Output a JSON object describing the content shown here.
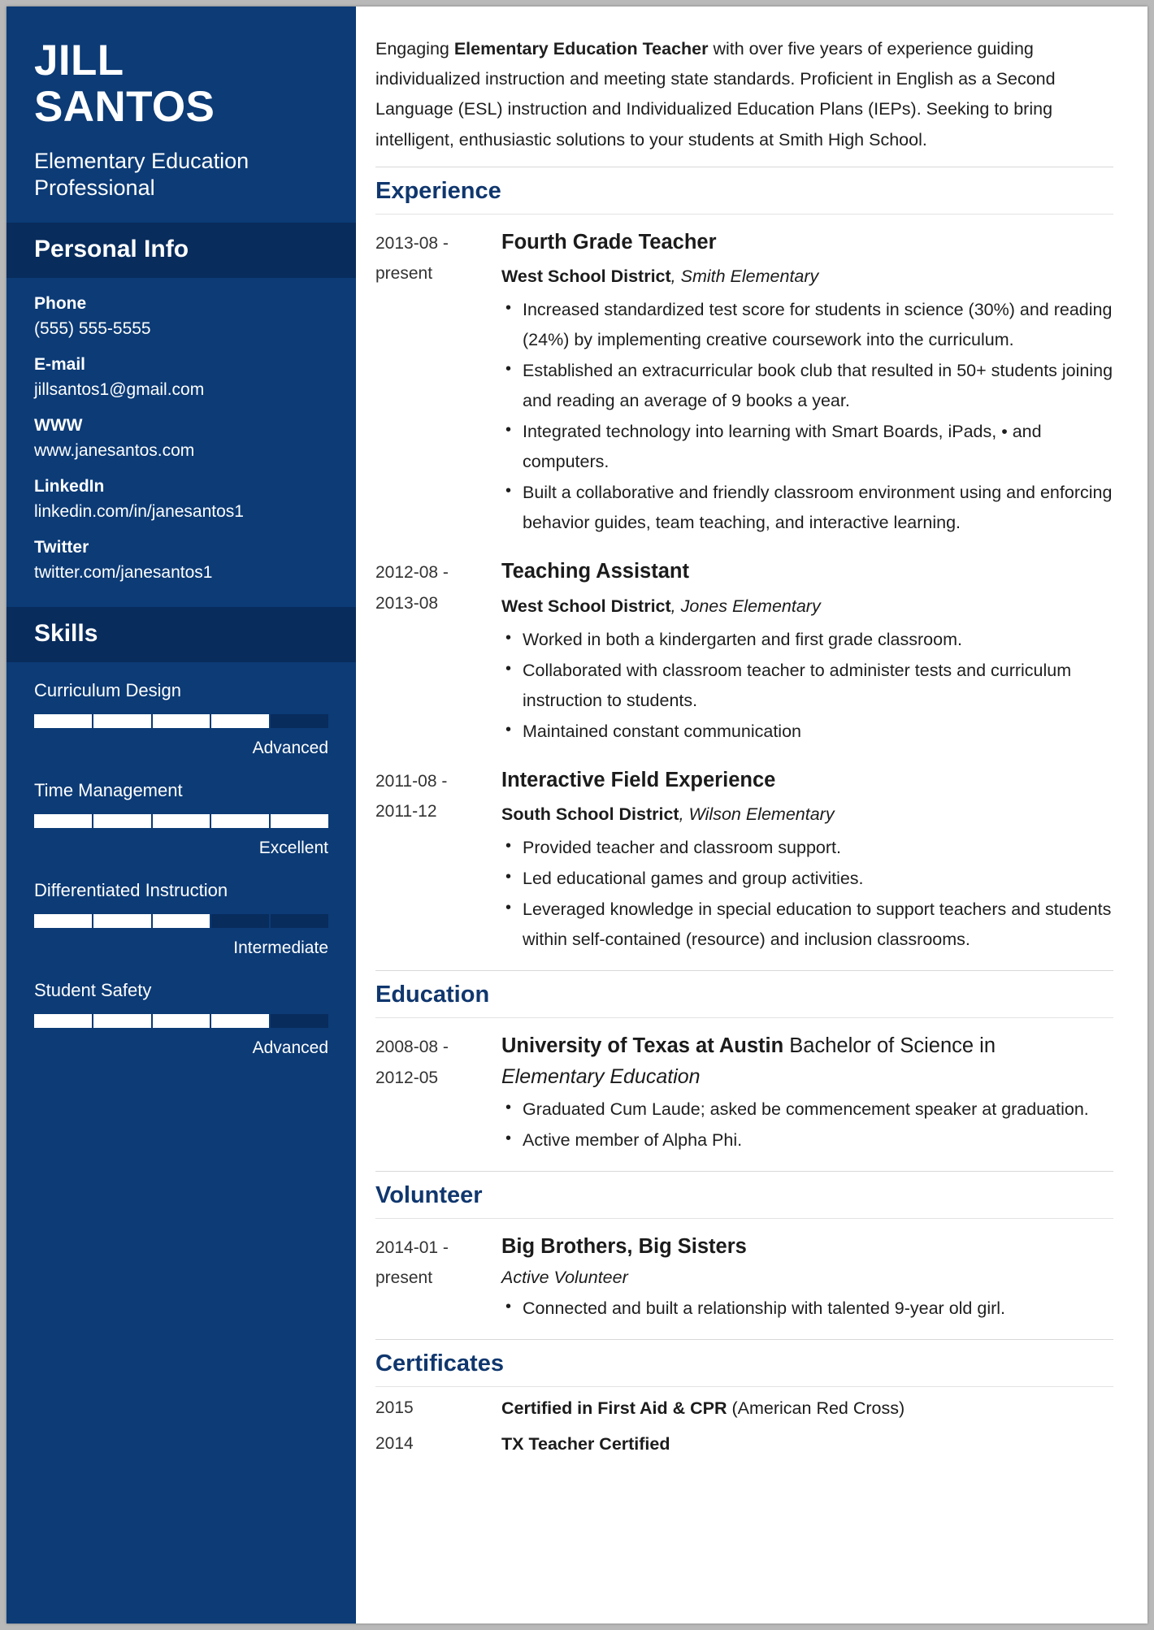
{
  "sidebar": {
    "first_name": "JILL",
    "last_name": "SANTOS",
    "job_title": "Elementary Education Professional",
    "personal_info": {
      "heading": "Personal Info",
      "items": [
        {
          "label": "Phone",
          "value": "(555) 555-5555"
        },
        {
          "label": "E-mail",
          "value": "jillsantos1@gmail.com"
        },
        {
          "label": "WWW",
          "value": "www.janesantos.com"
        },
        {
          "label": "LinkedIn",
          "value": "linkedin.com/in/janesantos1"
        },
        {
          "label": "Twitter",
          "value": "twitter.com/janesantos1"
        }
      ]
    },
    "skills": {
      "heading": "Skills",
      "items": [
        {
          "name": "Curriculum Design",
          "level": "Advanced",
          "percent": 80
        },
        {
          "name": "Time Management",
          "level": "Excellent",
          "percent": 100
        },
        {
          "name": "Differentiated Instruction",
          "level": "Intermediate",
          "percent": 60
        },
        {
          "name": "Student Safety",
          "level": "Advanced",
          "percent": 80
        }
      ]
    }
  },
  "main": {
    "summary": {
      "part1": "Engaging ",
      "bold1": "Elementary Education Teacher",
      "part2": " with over five years of experience guiding individualized instruction and meeting state standards. Proficient in English as a Second Language (ESL) instruction and Individualized Education Plans (IEPs). Seeking to bring intelligent, enthusiastic solutions to your students at Smith High School."
    },
    "experience": {
      "heading": "Experience",
      "entries": [
        {
          "date_from": "2013-08 -",
          "date_to": "present",
          "title": "Fourth Grade Teacher",
          "company": "West School District",
          "location": ", Smith Elementary",
          "bullets": [
            "Increased standardized test score for students in science (30%) and reading (24%) by implementing creative coursework into the curriculum.",
            "Established an extracurricular book club that resulted in 50+ students joining and reading an average of 9 books a year.",
            "Integrated technology into learning with Smart Boards, iPads, • and computers.",
            "Built a collaborative and friendly classroom environment using and enforcing behavior guides, team teaching, and interactive learning."
          ]
        },
        {
          "date_from": "2012-08 -",
          "date_to": "2013-08",
          "title": "Teaching Assistant",
          "company": "West School District",
          "location": ", Jones Elementary",
          "bullets": [
            "Worked in both a kindergarten and first grade classroom.",
            "Collaborated with classroom teacher to administer tests and curriculum instruction to students.",
            "Maintained constant communication"
          ]
        },
        {
          "date_from": "2011-08 -",
          "date_to": "2011-12",
          "title": "Interactive Field Experience",
          "company": "South School District",
          "location": ", Wilson Elementary",
          "bullets": [
            "Provided teacher and classroom support.",
            "Led educational games and group activities.",
            "Leveraged knowledge in special education to support teachers and students within self-contained (resource) and inclusion classrooms."
          ]
        }
      ]
    },
    "education": {
      "heading": "Education",
      "entries": [
        {
          "date_from": "2008-08 -",
          "date_to": "2012-05",
          "school": "University of Texas at Austin",
          "degree_rest": " Bachelor of Science in",
          "degree_italic": "Elementary Education",
          "bullets": [
            "Graduated Cum Laude; asked be commencement speaker at graduation.",
            "Active member of Alpha Phi."
          ]
        }
      ]
    },
    "volunteer": {
      "heading": "Volunteer",
      "entries": [
        {
          "date_from": "2014-01 -",
          "date_to": "present",
          "title": "Big Brothers, Big Sisters",
          "role": "Active Volunteer",
          "bullets": [
            "Connected and built a relationship with talented 9-year old girl."
          ]
        }
      ]
    },
    "certificates": {
      "heading": "Certificates",
      "rows": [
        {
          "year": "2015",
          "bold": "Certified in First Aid & CPR",
          "rest": " (American Red Cross)"
        },
        {
          "year": "2014",
          "bold": "TX Teacher Certified",
          "rest": ""
        }
      ]
    }
  },
  "colors": {
    "sidebar_bg": "#0c3b76",
    "sidebar_head_bg": "#082c5c",
    "accent_heading": "#10376e",
    "page_bg": "#b9b9b9"
  }
}
